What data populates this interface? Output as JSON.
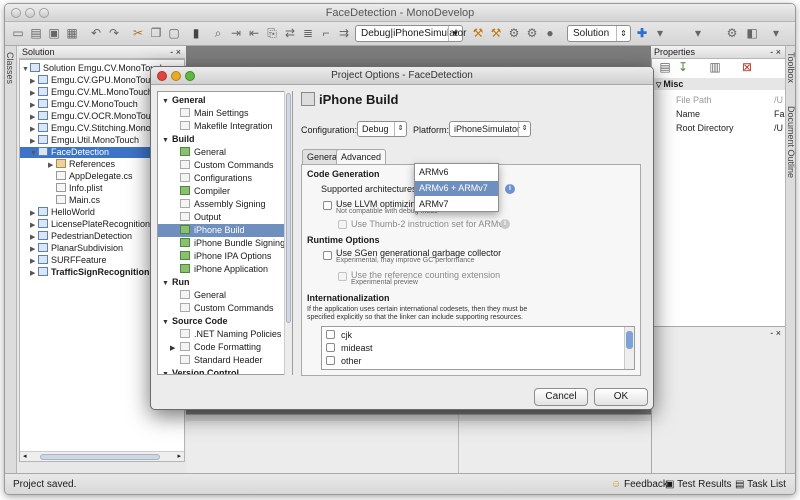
{
  "window": {
    "title": "FaceDetection - MonoDevelop"
  },
  "toolbar": {
    "config_select": "Debug|iPhoneSimulator",
    "search_scope": "Solution"
  },
  "sidebar": {
    "classes_label": "Classes",
    "solution_header": "Solution",
    "tree": [
      {
        "label": "Solution Emgu.CV.MonoTouch",
        "kind": "solution",
        "expanded": true,
        "bold": false,
        "selected": false
      },
      {
        "label": "Emgu.CV.GPU.MonoTouch",
        "kind": "project",
        "bold": false,
        "selected": false
      },
      {
        "label": "Emgu.CV.ML.MonoTouch",
        "kind": "project",
        "bold": false,
        "selected": false
      },
      {
        "label": "Emgu.CV.MonoTouch",
        "kind": "project",
        "bold": false,
        "selected": false
      },
      {
        "label": "Emgu.CV.OCR.MonoTouch",
        "kind": "project",
        "bold": false,
        "selected": false
      },
      {
        "label": "Emgu.CV.Stitching.MonoTo",
        "kind": "project",
        "bold": false,
        "selected": false
      },
      {
        "label": "Emgu.Util.MonoTouch",
        "kind": "project",
        "bold": false,
        "selected": false
      },
      {
        "label": "FaceDetection",
        "kind": "project",
        "expanded": true,
        "bold": false,
        "selected": true
      },
      {
        "label": "References",
        "kind": "folder",
        "bold": false,
        "selected": false
      },
      {
        "label": "AppDelegate.cs",
        "kind": "file",
        "bold": false,
        "selected": false
      },
      {
        "label": "Info.plist",
        "kind": "file",
        "bold": false,
        "selected": false
      },
      {
        "label": "Main.cs",
        "kind": "file",
        "bold": false,
        "selected": false
      },
      {
        "label": "HelloWorld",
        "kind": "project",
        "bold": false,
        "selected": false
      },
      {
        "label": "LicensePlateRecognition",
        "kind": "project",
        "bold": false,
        "selected": false
      },
      {
        "label": "PedestrianDetection",
        "kind": "project",
        "bold": false,
        "selected": false
      },
      {
        "label": "PlanarSubdivision",
        "kind": "project",
        "bold": false,
        "selected": false
      },
      {
        "label": "SURFFeature",
        "kind": "project",
        "bold": false,
        "selected": false
      },
      {
        "label": "TrafficSignRecognition",
        "kind": "project",
        "bold": true,
        "selected": false
      }
    ]
  },
  "properties": {
    "header": "Properties",
    "group": "Misc",
    "rows": [
      {
        "name": "File Path",
        "value": "/U",
        "dim": true
      },
      {
        "name": "Name",
        "value": "Fa",
        "dim": false
      },
      {
        "name": "Root Directory",
        "value": "/U",
        "dim": false
      }
    ],
    "toolbox_label": "Toolbox",
    "outline_label": "Document Outline"
  },
  "dialog": {
    "title": "Project Options - FaceDetection",
    "nav": [
      {
        "label": "General",
        "type": "category"
      },
      {
        "label": "Main Settings",
        "type": "item"
      },
      {
        "label": "Makefile Integration",
        "type": "item"
      },
      {
        "label": "Build",
        "type": "category"
      },
      {
        "label": "General",
        "type": "item",
        "colored": true
      },
      {
        "label": "Custom Commands",
        "type": "item"
      },
      {
        "label": "Configurations",
        "type": "item"
      },
      {
        "label": "Compiler",
        "type": "item",
        "colored": true
      },
      {
        "label": "Assembly Signing",
        "type": "item"
      },
      {
        "label": "Output",
        "type": "item"
      },
      {
        "label": "iPhone Build",
        "type": "item",
        "colored": true,
        "selected": true
      },
      {
        "label": "iPhone Bundle Signing",
        "type": "item",
        "colored": true
      },
      {
        "label": "iPhone IPA Options",
        "type": "item",
        "colored": true
      },
      {
        "label": "iPhone Application",
        "type": "item",
        "colored": true
      },
      {
        "label": "Run",
        "type": "category"
      },
      {
        "label": "General",
        "type": "item"
      },
      {
        "label": "Custom Commands",
        "type": "item"
      },
      {
        "label": "Source Code",
        "type": "category"
      },
      {
        "label": ".NET Naming Policies",
        "type": "item"
      },
      {
        "label": "Code Formatting",
        "type": "item",
        "expandable": true
      },
      {
        "label": "Standard Header",
        "type": "item"
      },
      {
        "label": "Version Control",
        "type": "category"
      }
    ],
    "page_title": "iPhone Build",
    "configuration_label": "Configuration:",
    "configuration_value": "Debug",
    "platform_label": "Platform:",
    "platform_value": "iPhoneSimulator",
    "tabs": [
      "General",
      "Advanced"
    ],
    "code_generation": {
      "heading": "Code Generation",
      "arch_label": "Supported architectures:",
      "llvm_label": "Use LLVM optimizing",
      "llvm_note": "Not compatible with debug mode",
      "thumb_label": "Use Thumb-2 instruction set for ARMv7"
    },
    "arch_dropdown": {
      "options": [
        "ARMv6",
        "ARMv6 + ARMv7",
        "ARMv7"
      ],
      "selected_index": 1
    },
    "runtime": {
      "heading": "Runtime Options",
      "sgen_label": "Use SGen generational garbage collector",
      "sgen_note": "Experimental, may improve GC performance",
      "refcount_label": "Use the reference counting extension",
      "refcount_note": "Experimental preview"
    },
    "i18n": {
      "heading": "Internationalization",
      "description_line1": "If the application uses certain international codesets, then they must be",
      "description_line2": "specified explicitly so that the linker can include supporting resources.",
      "codesets": [
        "cjk",
        "mideast",
        "other"
      ]
    },
    "cancel_label": "Cancel",
    "ok_label": "OK"
  },
  "statusbar": {
    "message": "Project saved.",
    "feedback": "Feedback",
    "test_results": "Test Results",
    "task_list": "Task List"
  }
}
